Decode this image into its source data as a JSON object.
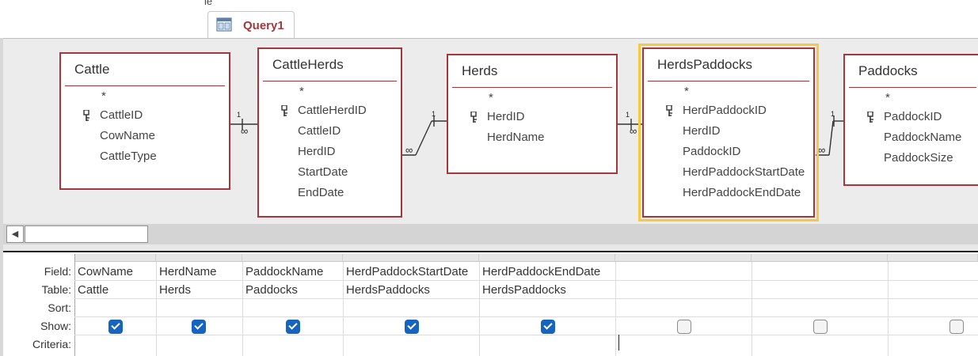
{
  "tabs": {
    "stub_label": "le",
    "active_tab": "Query1"
  },
  "design_tables": [
    {
      "name": "Cattle",
      "star": "*",
      "fields": [
        "CattleID",
        "CowName",
        "CattleType"
      ],
      "key_index": 0,
      "selected": false
    },
    {
      "name": "CattleHerds",
      "star": "*",
      "fields": [
        "CattleHerdID",
        "CattleID",
        "HerdID",
        "StartDate",
        "EndDate"
      ],
      "key_index": 0,
      "selected": false
    },
    {
      "name": "Herds",
      "star": "*",
      "fields": [
        "HerdID",
        "HerdName"
      ],
      "key_index": 0,
      "selected": false
    },
    {
      "name": "HerdsPaddocks",
      "star": "*",
      "fields": [
        "HerdPaddockID",
        "HerdID",
        "PaddockID",
        "HerdPaddockStartDate",
        "HerdPaddockEndDate"
      ],
      "key_index": 0,
      "selected": true
    },
    {
      "name": "Paddocks",
      "star": "*",
      "fields": [
        "PaddockID",
        "PaddockName",
        "PaddockSize"
      ],
      "key_index": 0,
      "selected": false
    }
  ],
  "relationships": [
    {
      "from": "Cattle",
      "to": "CattleHerds",
      "one_label": "1",
      "many_label": "∞"
    },
    {
      "from": "CattleHerds",
      "to": "Herds",
      "one_label": "1",
      "many_label": "∞"
    },
    {
      "from": "Herds",
      "to": "HerdsPaddocks",
      "one_label": "1",
      "many_label": "∞"
    },
    {
      "from": "HerdsPaddocks",
      "to": "Paddocks",
      "one_label": "1",
      "many_label": "∞"
    }
  ],
  "grid": {
    "row_labels": {
      "field": "Field:",
      "table": "Table:",
      "sort": "Sort:",
      "show": "Show:",
      "criteria": "Criteria:"
    },
    "columns": [
      {
        "field": "CowName",
        "table": "Cattle",
        "sort": "",
        "show": true,
        "criteria": ""
      },
      {
        "field": "HerdName",
        "table": "Herds",
        "sort": "",
        "show": true,
        "criteria": ""
      },
      {
        "field": "PaddockName",
        "table": "Paddocks",
        "sort": "",
        "show": true,
        "criteria": ""
      },
      {
        "field": "HerdPaddockStartDate",
        "table": "HerdsPaddocks",
        "sort": "",
        "show": true,
        "criteria": ""
      },
      {
        "field": "HerdPaddockEndDate",
        "table": "HerdsPaddocks",
        "sort": "",
        "show": true,
        "criteria": ""
      },
      {
        "field": "",
        "table": "",
        "sort": "",
        "show": false,
        "criteria": ""
      },
      {
        "field": "",
        "table": "",
        "sort": "",
        "show": false,
        "criteria": ""
      },
      {
        "field": "",
        "table": "",
        "sort": "",
        "show": false,
        "criteria": ""
      }
    ]
  },
  "colors": {
    "table_border": "#a4373a",
    "selected_outline": "#f7c843",
    "checkbox_on": "#1565c0",
    "tab_text": "#a4373a"
  },
  "icons": {
    "query_tab": "query-icon",
    "primary_key": "key-icon",
    "scroll_left": "scroll-left-arrow-icon"
  }
}
